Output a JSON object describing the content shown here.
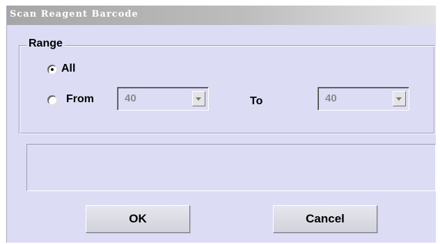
{
  "dialog": {
    "title": "Scan Reagent Barcode",
    "range": {
      "legend": "Range",
      "options": [
        {
          "label": "All",
          "selected": true
        },
        {
          "label": "From",
          "selected": false
        }
      ],
      "from_value": "40",
      "to_label": "To",
      "to_value": "40"
    },
    "status_text": "",
    "buttons": {
      "ok": "OK",
      "cancel": "Cancel"
    }
  }
}
